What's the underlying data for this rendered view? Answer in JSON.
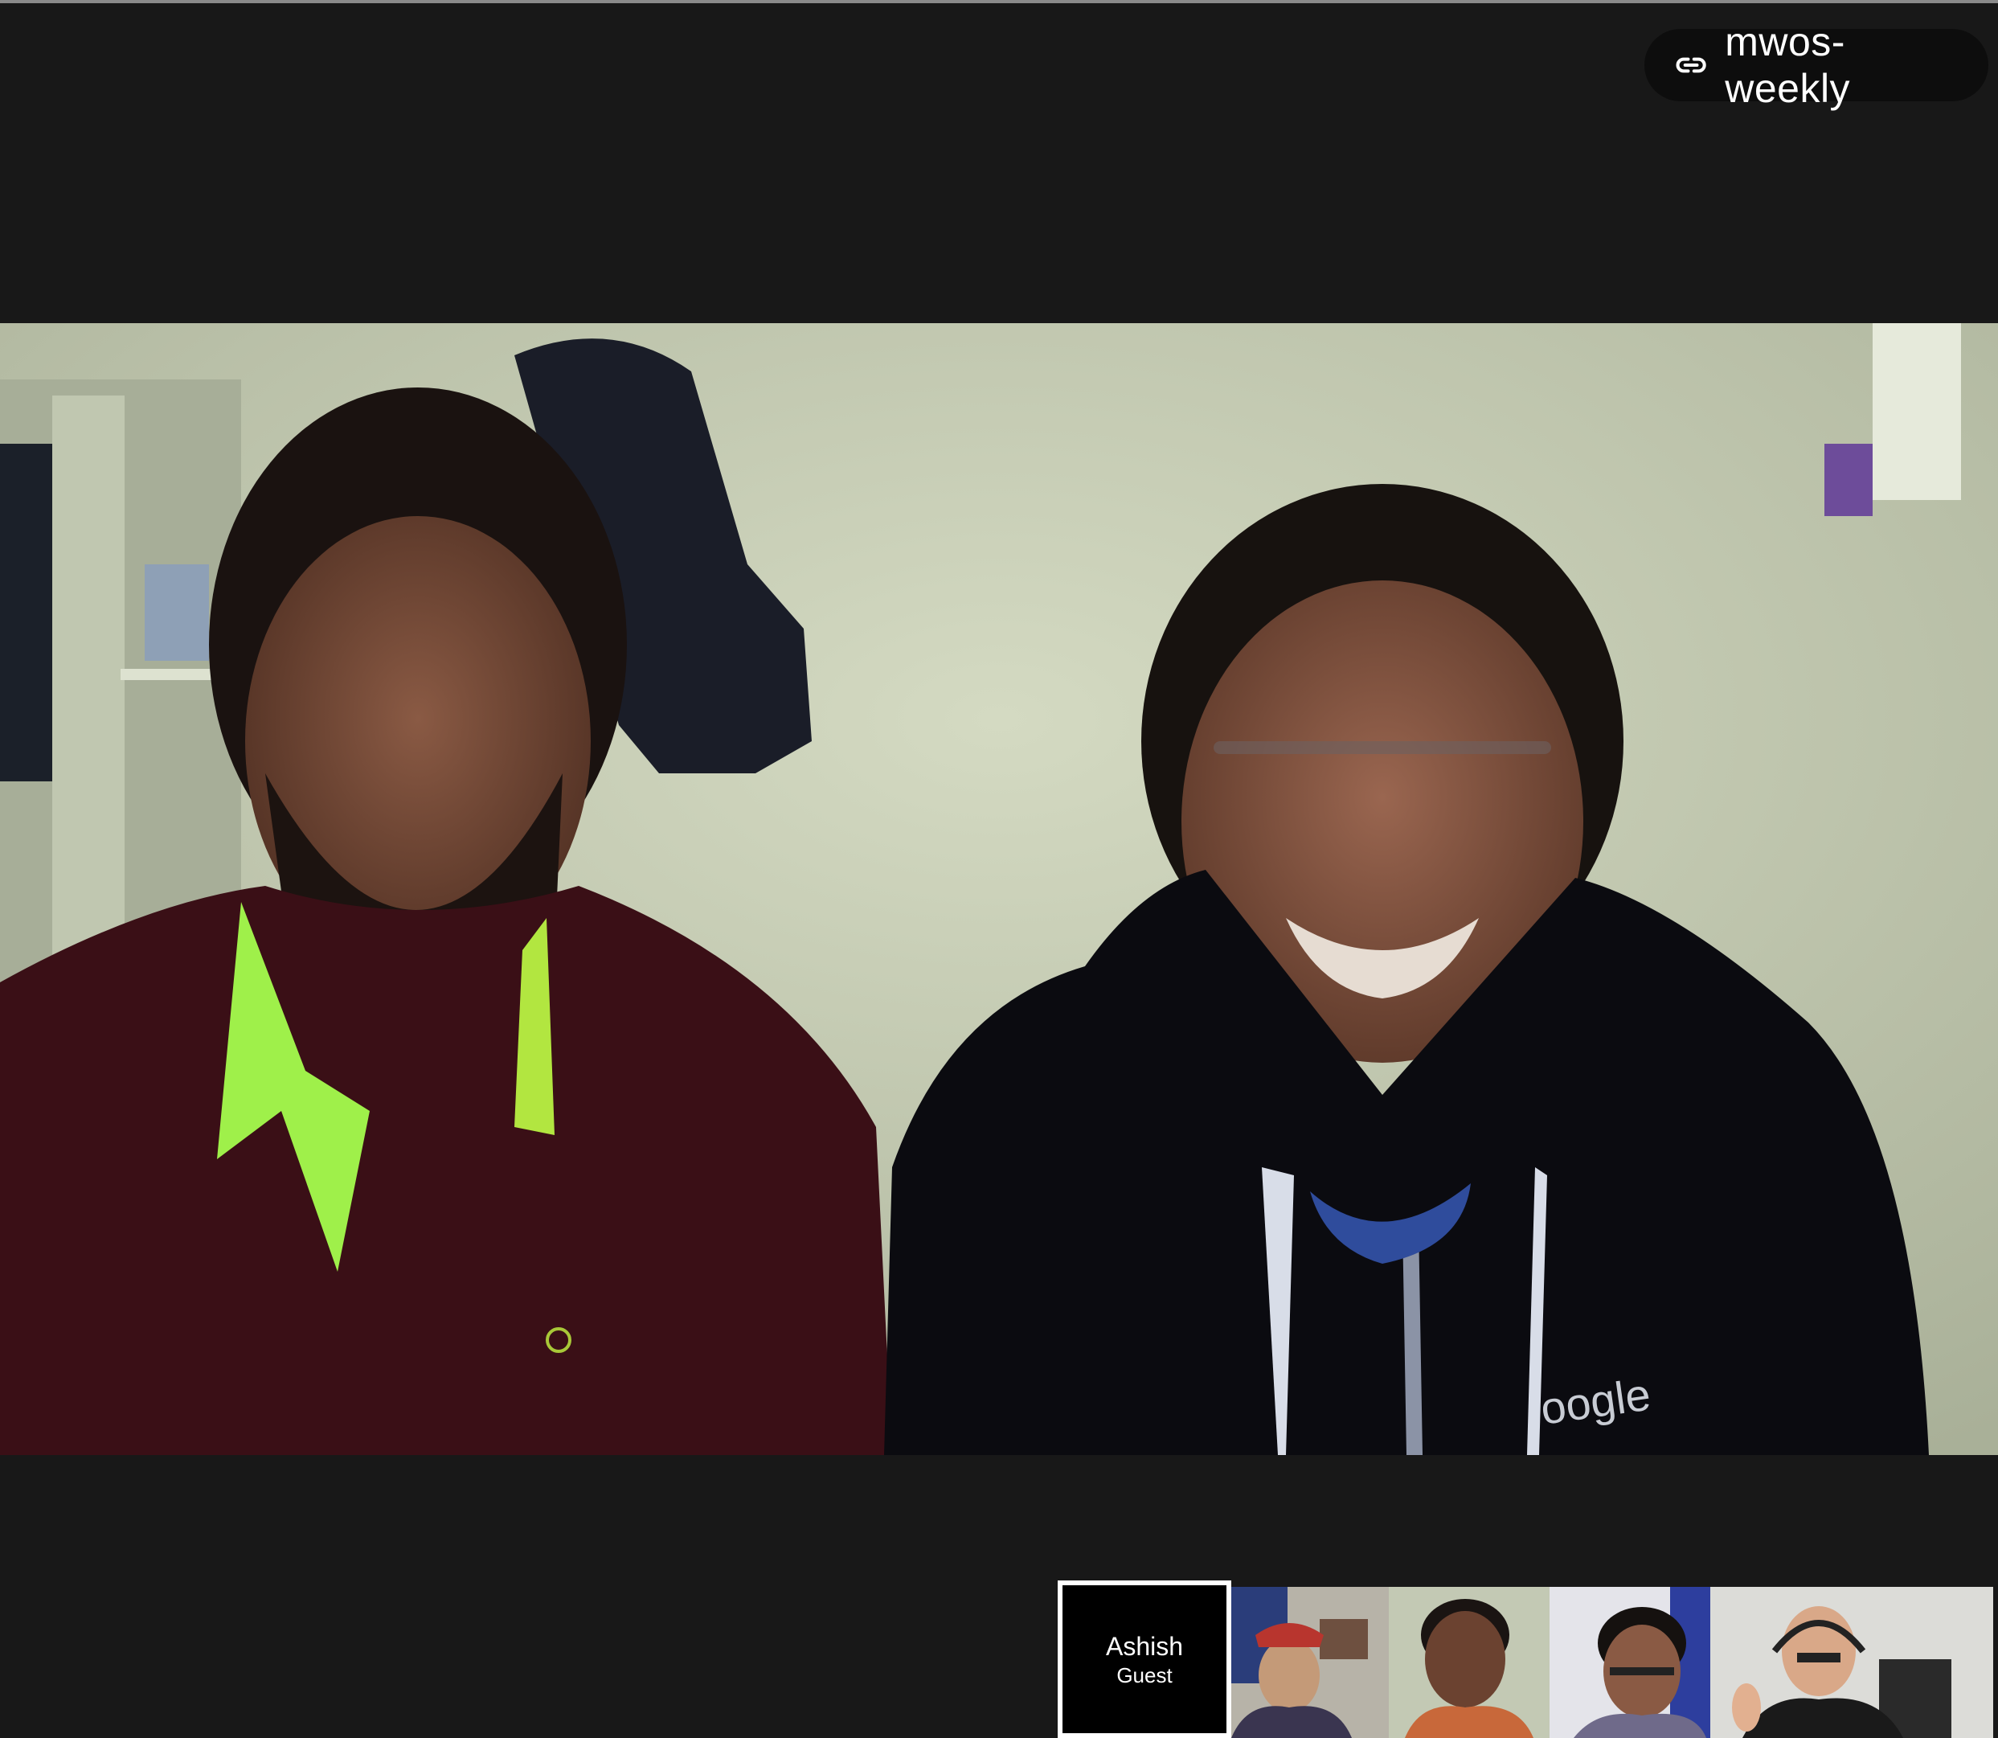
{
  "meeting": {
    "name": "mwos-weekly",
    "link_icon": "link-icon"
  },
  "main_video": {
    "shirt_logo_text": "oogle"
  },
  "filmstrip": {
    "self": {
      "name": "Ashish",
      "role": "Guest"
    },
    "tiles": [
      {
        "id": "participant-1"
      },
      {
        "id": "participant-2"
      },
      {
        "id": "participant-3"
      },
      {
        "id": "participant-4"
      }
    ]
  },
  "colors": {
    "background": "#181818",
    "chip_background": "#0d0d0d",
    "self_tile_border": "#ffffff"
  }
}
